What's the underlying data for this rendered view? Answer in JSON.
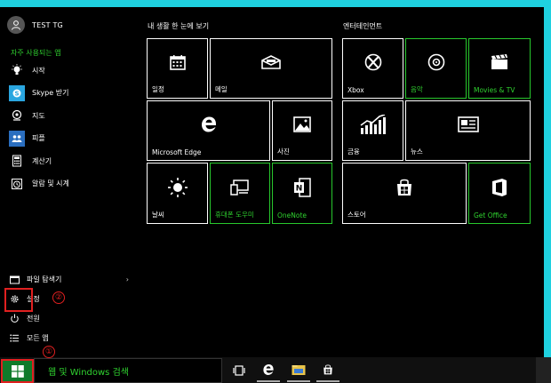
{
  "user": {
    "name": "TEST TG"
  },
  "frequent": {
    "title": "자주 사용되는 앱",
    "apps": [
      {
        "label": "시작",
        "icon": "lightbulb-icon"
      },
      {
        "label": "Skype 받기",
        "icon": "skype-icon"
      },
      {
        "label": "지도",
        "icon": "maps-icon"
      },
      {
        "label": "피플",
        "icon": "people-icon"
      },
      {
        "label": "계산기",
        "icon": "calculator-icon"
      },
      {
        "label": "알람 및 시계",
        "icon": "alarm-icon"
      }
    ]
  },
  "bottom": {
    "explorer": "파일 탐색기",
    "settings": "설정",
    "power": "전원",
    "all_apps": "모든 앱"
  },
  "annotations": {
    "mark1": "①",
    "mark2": "②"
  },
  "groups": {
    "left": "내 생활 한 눈에 보기",
    "right": "엔터테인먼트"
  },
  "tiles": {
    "calendar": "일정",
    "mail": "메일",
    "xbox": "Xbox",
    "music": "음악",
    "movies": "Movies & TV",
    "edge": "Microsoft Edge",
    "photos": "사진",
    "money": "금융",
    "news": "뉴스",
    "weather": "날씨",
    "phone": "휴대폰 도우미",
    "onenote": "OneNote",
    "store": "스토어",
    "office": "Get Office"
  },
  "taskbar": {
    "search_text": "웹 및 Windows 검색"
  },
  "colors": {
    "accent_green": "#2fd22f",
    "frame_cyan": "#1fd1e0",
    "highlight_red": "#e02020",
    "start_green": "#0f7a2a"
  }
}
